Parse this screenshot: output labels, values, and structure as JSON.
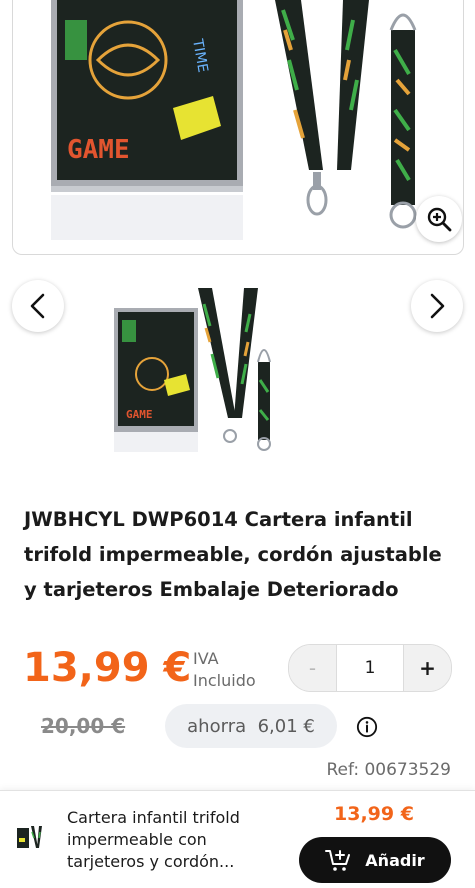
{
  "product": {
    "title": "JWBHCYL DWP6014 Cartera infantil trifold impermeable, cordón ajustable y tarjeteros Embalaje Deteriorado",
    "price": "13,99 €",
    "tax_note_line1": "IVA",
    "tax_note_line2": "Incluido",
    "old_price": "20,00 €",
    "savings": "ahorra  6,01 €",
    "reference": "Ref: 00673529",
    "main_image_text": "GAME"
  },
  "quantity": {
    "minus_label": "-",
    "value": "1",
    "plus_label": "+"
  },
  "gallery": {
    "prev_icon": "chevron-left-icon",
    "next_icon": "chevron-right-icon",
    "zoom_icon": "zoom-in-icon"
  },
  "sticky_bar": {
    "product_name": "Cartera infantil trifold impermeable con tarjeteros y cordón...",
    "price": "13,99 €",
    "add_label": "Añadir",
    "cart_icon": "cart-add-icon"
  },
  "colors": {
    "accent": "#f26419",
    "button_dark": "#111111",
    "pill_bg": "#eef0f3"
  }
}
